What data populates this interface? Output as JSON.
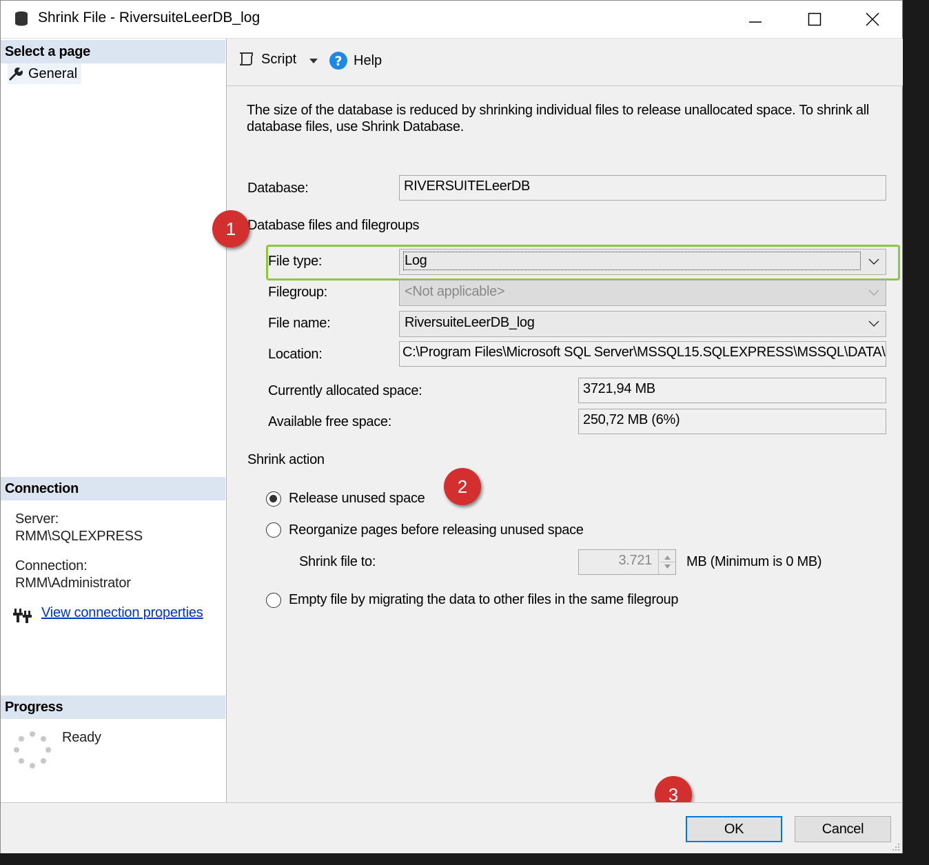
{
  "window": {
    "title": "Shrink File - RiversuiteLeerDB_log"
  },
  "left_pane": {
    "select_page_header": "Select a page",
    "pages": [
      {
        "label": "General"
      }
    ],
    "connection_header": "Connection",
    "server_label": "Server:",
    "server_value": "RMM\\SQLEXPRESS",
    "connection_label": "Connection:",
    "connection_value": "RMM\\Administrator",
    "view_connection_link": "View connection properties",
    "progress_header": "Progress",
    "progress_status": "Ready"
  },
  "toolbar": {
    "script_label": "Script",
    "help_label": "Help"
  },
  "main": {
    "description": "The size of the database is reduced by shrinking individual files to release unallocated space. To shrink all database files, use Shrink Database.",
    "database_label": "Database:",
    "database_value": "RIVERSUITELeerDB",
    "files_group_label": "Database files and filegroups",
    "file_type_label": "File type:",
    "file_type_value": "Log",
    "filegroup_label": "Filegroup:",
    "filegroup_value": "<Not applicable>",
    "file_name_label": "File name:",
    "file_name_value": "RiversuiteLeerDB_log",
    "location_label": "Location:",
    "location_value": "C:\\Program Files\\Microsoft SQL Server\\MSSQL15.SQLEXPRESS\\MSSQL\\DATA\\RiversuiteLeerDB_log.ldf",
    "allocated_label": "Currently allocated space:",
    "allocated_value": "3721,94 MB",
    "free_label": "Available free space:",
    "free_value": "250,72 MB (6%)",
    "shrink_action_label": "Shrink action",
    "options": {
      "release": "Release unused space",
      "reorganize": "Reorganize pages before releasing unused space",
      "empty": "Empty file by migrating the data to other files in the same filegroup"
    },
    "selected_option": "release",
    "shrink_to_label": "Shrink file to:",
    "shrink_to_value": "3.721",
    "shrink_to_unit": "MB (Minimum is 0 MB)"
  },
  "annotations": {
    "step1": "1",
    "step2": "2",
    "step3": "3",
    "highlight_color": "#8dc63f",
    "badge_color": "#d32f2f"
  },
  "footer": {
    "ok_label": "OK",
    "cancel_label": "Cancel"
  }
}
